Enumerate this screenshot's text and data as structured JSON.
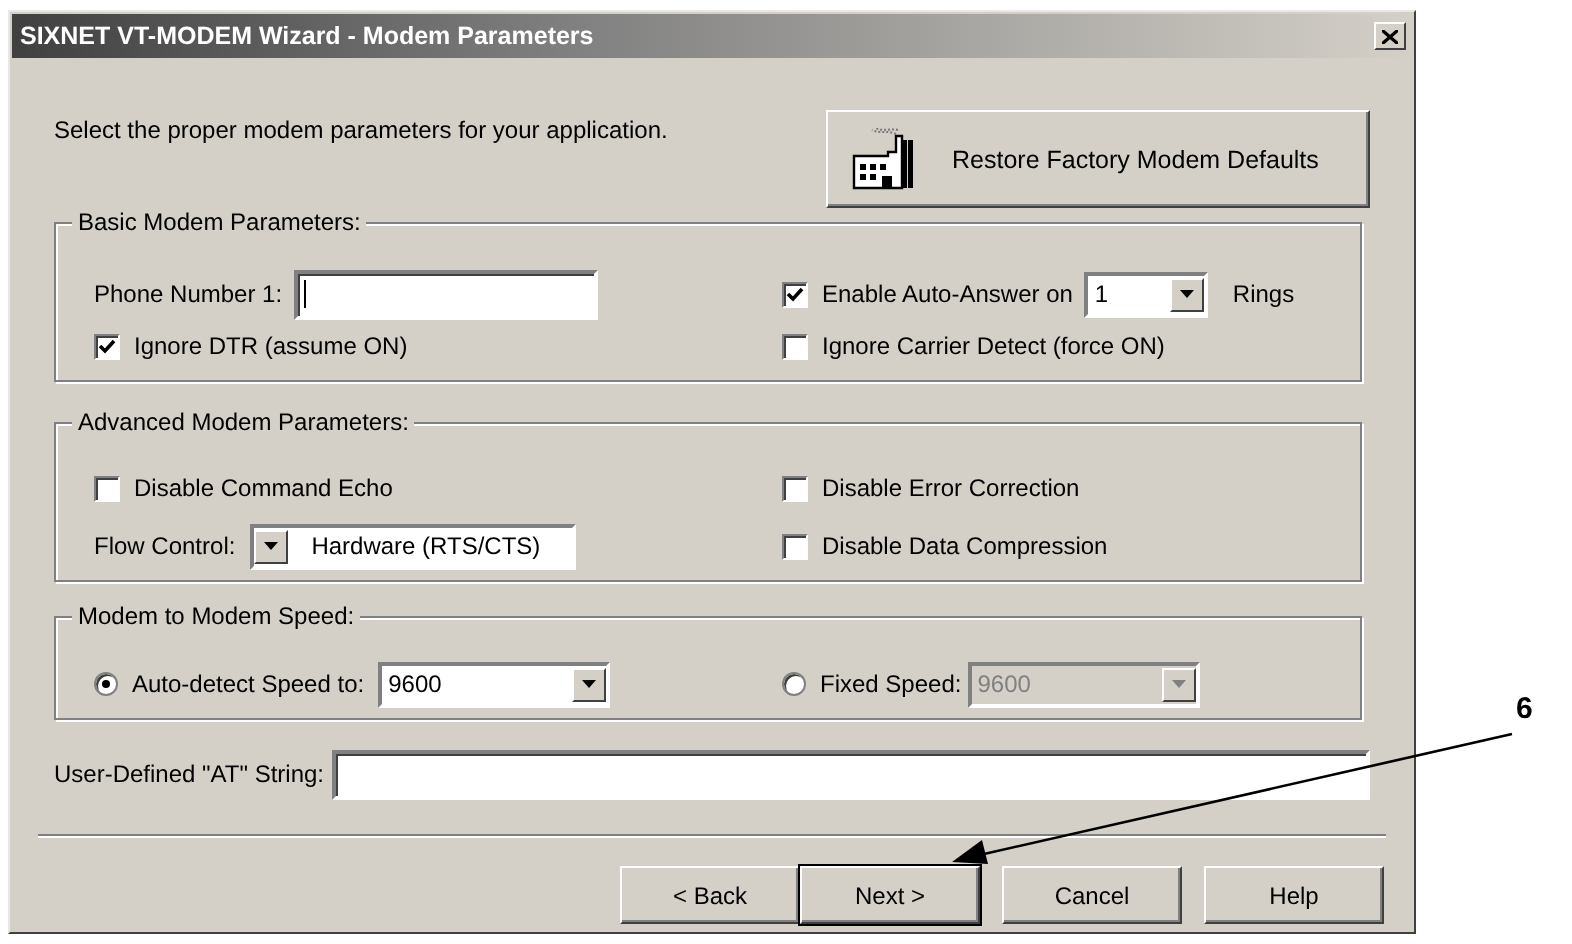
{
  "window": {
    "title": "SIXNET VT-MODEM Wizard - Modem Parameters"
  },
  "intro": "Select the proper modem parameters for your application.",
  "restore_button": "Restore Factory Modem Defaults",
  "basic": {
    "title": "Basic Modem Parameters:",
    "phone": {
      "label": "Phone Number 1:"
    },
    "auto_answer": {
      "label": "Enable Auto-Answer on",
      "checked": true,
      "value": "1",
      "suffix": "Rings"
    },
    "ignore_dtr": {
      "label": "Ignore DTR (assume ON)",
      "checked": true
    },
    "ignore_carrier": {
      "label": "Ignore Carrier Detect (force ON)",
      "checked": false
    }
  },
  "advanced": {
    "title": "Advanced Modem Parameters:",
    "command_echo": {
      "label": "Disable Command Echo",
      "checked": false
    },
    "flow_control": {
      "label": "Flow Control:",
      "value": "Hardware (RTS/CTS)"
    },
    "error_correction": {
      "label": "Disable Error Correction",
      "checked": false
    },
    "data_compression": {
      "label": "Disable Data Compression",
      "checked": false
    }
  },
  "speed": {
    "title": "Modem to Modem Speed:",
    "options": [
      {
        "label": "Auto-detect Speed to:",
        "selected": true,
        "value": "9600",
        "disabled": false
      },
      {
        "label": "Fixed Speed:",
        "selected": false,
        "value": "9600",
        "disabled": true
      }
    ]
  },
  "at_string": {
    "label": "User-Defined \"AT\" String:"
  },
  "buttons": [
    {
      "label": "< Back",
      "default": false
    },
    {
      "label": "Next >",
      "default": true
    },
    {
      "label": "Cancel",
      "default": false
    },
    {
      "label": "Help",
      "default": false
    }
  ],
  "callout": {
    "label": "6"
  }
}
